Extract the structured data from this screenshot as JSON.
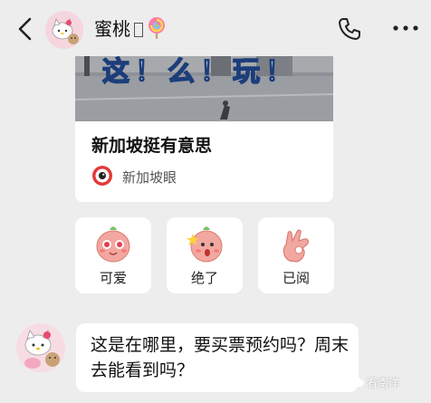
{
  "header": {
    "contact_name": "蜜桃",
    "back": "back-arrow-icon",
    "call": "phone-icon",
    "more": "more-dots-icon"
  },
  "link_card": {
    "image_caption": "这！么！玩！",
    "title": "新加坡挺有意思",
    "source": "新加坡眼"
  },
  "reactions": [
    {
      "label": "可爱",
      "icon": "cute-face-sticker-icon"
    },
    {
      "label": "绝了",
      "icon": "wow-face-sticker-icon"
    },
    {
      "label": "已阅",
      "icon": "ok-hand-sticker-icon"
    }
  ],
  "message": {
    "text": "这是在哪里，要买票预约吗？周末去能看到吗？"
  },
  "watermark": "看南洋",
  "colors": {
    "background": "#ededed",
    "card": "#ffffff",
    "sticker_pink": "#f2a7a0"
  }
}
